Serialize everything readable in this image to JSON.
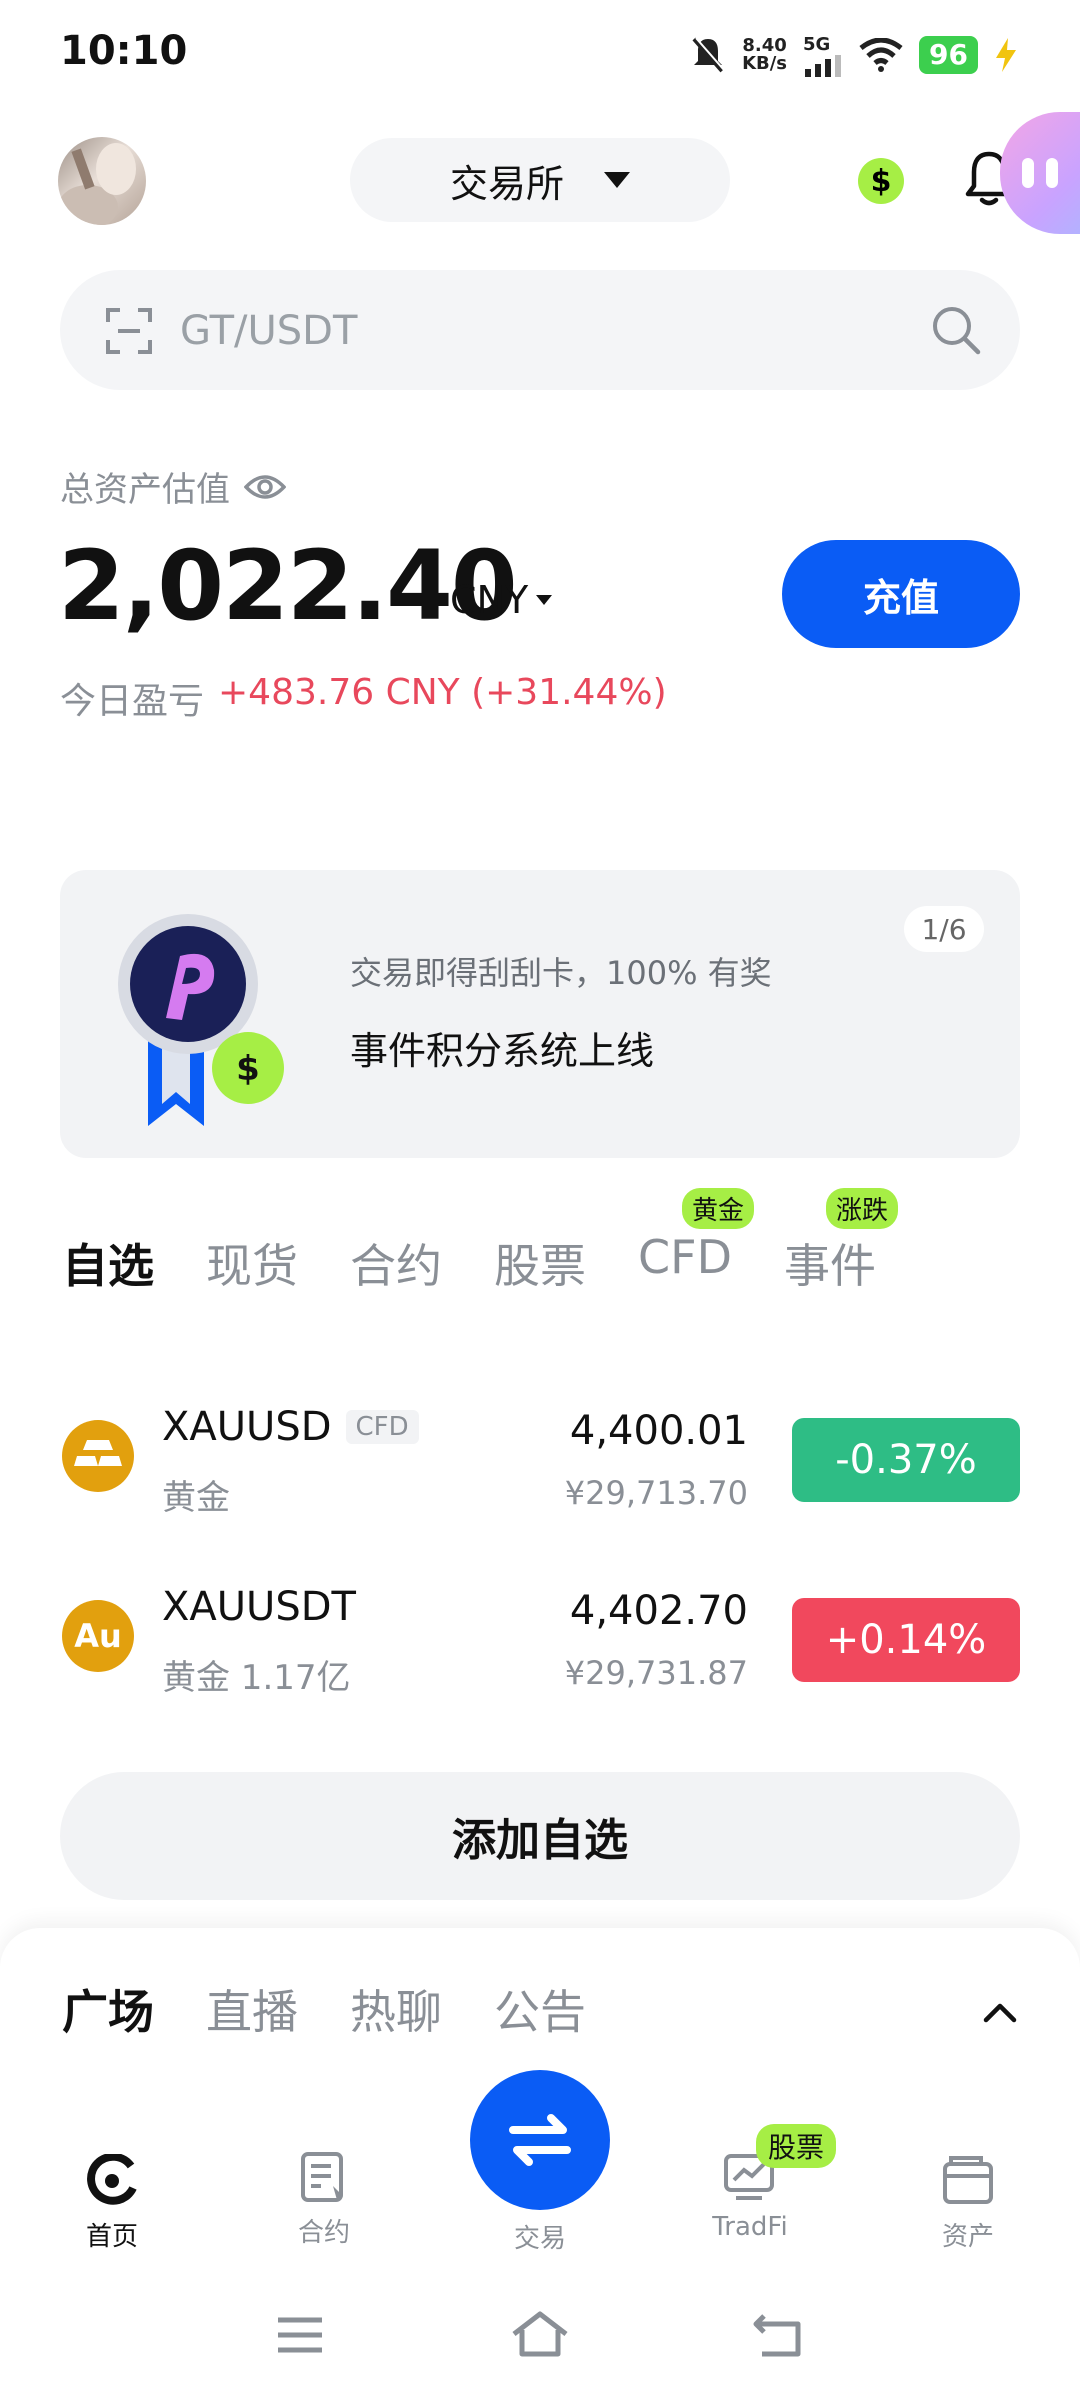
{
  "status_bar": {
    "time": "10:10",
    "net_speed_value": "8.40",
    "net_speed_unit": "KB/s",
    "network": "5G",
    "battery": "96"
  },
  "header": {
    "exchange_label": "交易所",
    "coin_symbol": "$"
  },
  "search": {
    "placeholder": "GT/USDT"
  },
  "assets": {
    "label": "总资产估值",
    "value": "2,022.40",
    "currency": "CNY",
    "deposit_label": "充值",
    "pnl_label": "今日盈亏",
    "pnl_value": "+483.76 CNY (+31.44%)"
  },
  "banner": {
    "page": "1/6",
    "subtitle": "交易即得刮刮卡，100% 有奖",
    "title": "事件积分系统上线",
    "medal_coin": "$"
  },
  "market_tabs": [
    {
      "label": "自选",
      "badge": ""
    },
    {
      "label": "现货",
      "badge": ""
    },
    {
      "label": "合约",
      "badge": ""
    },
    {
      "label": "股票",
      "badge": ""
    },
    {
      "label": "CFD",
      "badge": "黄金"
    },
    {
      "label": "事件",
      "badge": "涨跌"
    }
  ],
  "watchlist": [
    {
      "symbol": "XAUUSD",
      "tag": "CFD",
      "name": "黄金",
      "price": "4,400.01",
      "price_cny": "¥29,713.70",
      "change": "-0.37%",
      "icon_text": "",
      "change_color": "#2ebd85"
    },
    {
      "symbol": "XAUUSDT",
      "tag": "",
      "name": "黄金 1.17亿",
      "price": "4,402.70",
      "price_cny": "¥29,731.87",
      "change": "+0.14%",
      "icon_text": "Au",
      "change_color": "#f1485d"
    }
  ],
  "add_watchlist_label": "添加自选",
  "sheet_tabs": [
    "广场",
    "直播",
    "热聊",
    "公告"
  ],
  "bottom_nav": {
    "home": "首页",
    "futures": "合约",
    "trade": "交易",
    "tradfi": "TradFi",
    "tradfi_badge": "股票",
    "assets": "资产"
  },
  "colors": {
    "accent": "#0a5cf5",
    "up": "#2ebd85",
    "down": "#f1485d",
    "badge": "#a6ee45"
  }
}
